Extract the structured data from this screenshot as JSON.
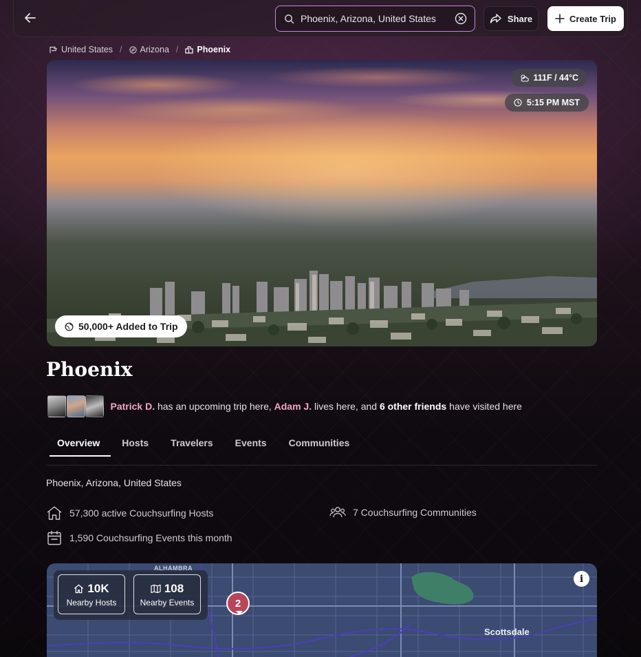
{
  "header": {
    "search_value": "Phoenix, Arizona, United States",
    "share_label": "Share",
    "create_trip_label": "Create Trip"
  },
  "breadcrumb": {
    "items": [
      {
        "label": "United States",
        "icon": "flag-icon"
      },
      {
        "label": "Arizona",
        "icon": "compass-icon"
      },
      {
        "label": "Phoenix",
        "icon": "city-icon"
      }
    ]
  },
  "hero": {
    "temperature": "111F / 44°C",
    "local_time": "5:15 PM MST",
    "added_to_trip": "50,000+ Added to Trip"
  },
  "city": {
    "name": "Phoenix",
    "location": "Phoenix, Arizona, United States"
  },
  "friends": {
    "friend1": "Patrick D.",
    "text1": " has an upcoming trip here, ",
    "friend2": "Adam J.",
    "text2": " lives here, and ",
    "others": "6 other friends",
    "text3": " have visited here"
  },
  "tabs": [
    {
      "label": "Overview",
      "active": true
    },
    {
      "label": "Hosts",
      "active": false
    },
    {
      "label": "Travelers",
      "active": false
    },
    {
      "label": "Events",
      "active": false
    },
    {
      "label": "Communities",
      "active": false
    }
  ],
  "stats": {
    "hosts": "57,300 active Couchsurfing Hosts",
    "communities": "7 Couchsurfing Communities",
    "events": "1,590 Couchsurfing Events this month"
  },
  "map": {
    "nearby_hosts_count": "10K",
    "nearby_hosts_label": "Nearby Hosts",
    "nearby_events_count": "108",
    "nearby_events_label": "Nearby Events",
    "cluster_count": "2",
    "place_scottsdale": "Scottsdale",
    "place_alhambra": "ALHAMBRA",
    "info_label": "i"
  },
  "colors": {
    "accent_search_border": "#c986d6",
    "friend_link": "#f0a7c8",
    "map_water": "#3b4b72",
    "cluster_pin": "#b8465a"
  }
}
